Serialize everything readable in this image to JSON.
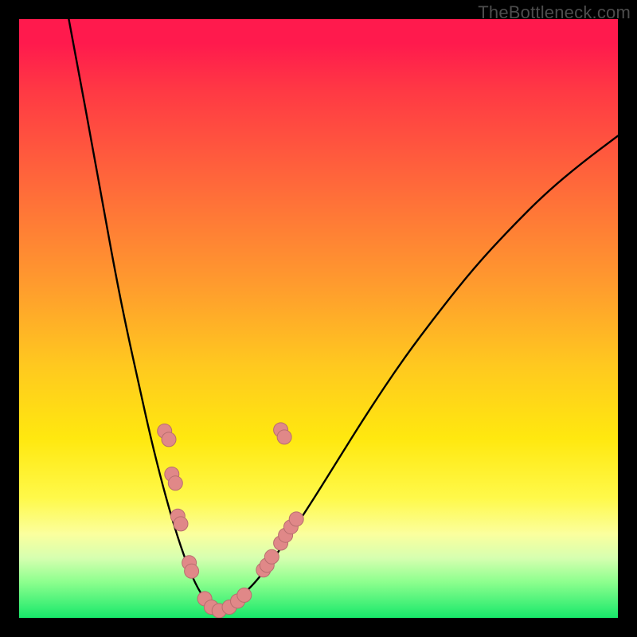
{
  "watermark": "TheBottleneck.com",
  "colors": {
    "curve": "#000000",
    "marker_fill": "#e08888",
    "marker_stroke": "#b86e6e"
  },
  "chart_data": {
    "type": "line",
    "title": "",
    "xlabel": "",
    "ylabel": "",
    "xlim": [
      0,
      100
    ],
    "ylim": [
      0,
      100
    ],
    "grid": false,
    "legend": false,
    "note": "Bottleneck-style V-curve. Values are read in plot-fraction coordinates (0..1), origin top-left, since the figure has no numeric axes.",
    "series": [
      {
        "name": "left-branch",
        "kind": "curve",
        "points_xy_frac": [
          [
            0.083,
            0.0
          ],
          [
            0.1,
            0.09
          ],
          [
            0.12,
            0.2
          ],
          [
            0.14,
            0.31
          ],
          [
            0.16,
            0.42
          ],
          [
            0.18,
            0.52
          ],
          [
            0.2,
            0.61
          ],
          [
            0.22,
            0.7
          ],
          [
            0.24,
            0.78
          ],
          [
            0.26,
            0.85
          ],
          [
            0.28,
            0.91
          ],
          [
            0.3,
            0.955
          ],
          [
            0.32,
            0.98
          ],
          [
            0.333,
            0.99
          ]
        ]
      },
      {
        "name": "right-branch",
        "kind": "curve",
        "points_xy_frac": [
          [
            0.333,
            0.99
          ],
          [
            0.37,
            0.965
          ],
          [
            0.4,
            0.935
          ],
          [
            0.44,
            0.88
          ],
          [
            0.48,
            0.82
          ],
          [
            0.53,
            0.74
          ],
          [
            0.58,
            0.66
          ],
          [
            0.64,
            0.57
          ],
          [
            0.7,
            0.49
          ],
          [
            0.76,
            0.415
          ],
          [
            0.82,
            0.35
          ],
          [
            0.88,
            0.29
          ],
          [
            0.94,
            0.24
          ],
          [
            1.0,
            0.195
          ]
        ]
      },
      {
        "name": "highlighted-points",
        "kind": "markers",
        "points_xy_frac": [
          [
            0.243,
            0.688
          ],
          [
            0.25,
            0.702
          ],
          [
            0.255,
            0.76
          ],
          [
            0.261,
            0.775
          ],
          [
            0.265,
            0.83
          ],
          [
            0.27,
            0.843
          ],
          [
            0.284,
            0.908
          ],
          [
            0.288,
            0.922
          ],
          [
            0.31,
            0.968
          ],
          [
            0.321,
            0.982
          ],
          [
            0.334,
            0.988
          ],
          [
            0.351,
            0.982
          ],
          [
            0.365,
            0.972
          ],
          [
            0.376,
            0.962
          ],
          [
            0.408,
            0.92
          ],
          [
            0.414,
            0.912
          ],
          [
            0.422,
            0.898
          ],
          [
            0.437,
            0.875
          ],
          [
            0.445,
            0.862
          ],
          [
            0.454,
            0.848
          ],
          [
            0.463,
            0.835
          ],
          [
            0.437,
            0.686
          ],
          [
            0.443,
            0.698
          ]
        ]
      }
    ]
  }
}
